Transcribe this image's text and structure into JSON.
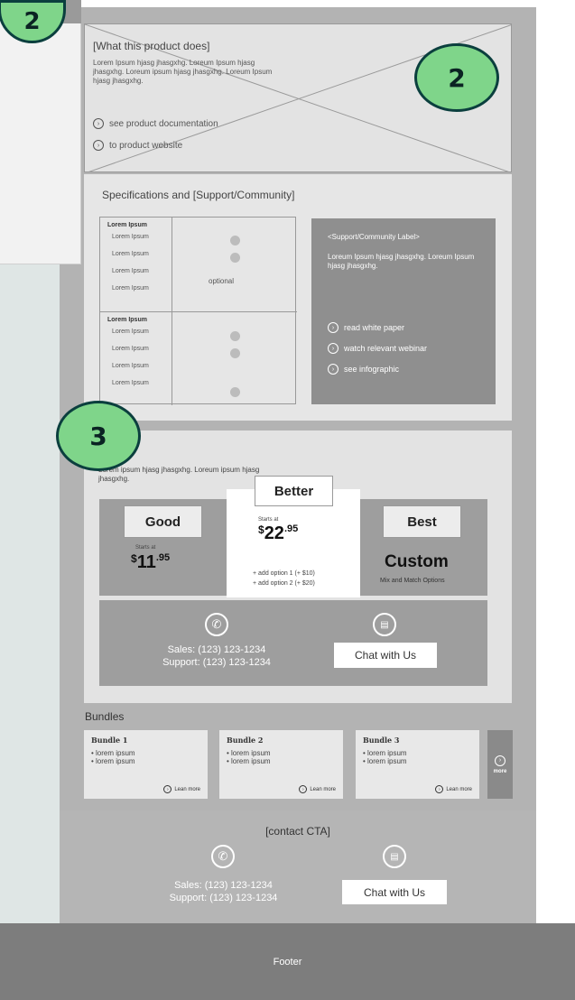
{
  "product": {
    "heading": "[What this product does]",
    "body": "Lorem Ipsum hjasg jhasgxhg. Loreum Ipsum hjasg jhasgxhg. Loreum ipsum hjasg jhasgxhg. Loreum Ipsum hjasg jhasgxhg.",
    "links": [
      "see product documentation",
      "to product website"
    ]
  },
  "badges": [
    "2",
    "2",
    "3"
  ],
  "specs": {
    "heading": "Specifications and [Support/Community]",
    "groups": [
      {
        "title": "Lorem Ipsum",
        "rows": [
          "Lorem Ipsum",
          "Lorem Ipsum",
          "Lorem Ipsum",
          "Lorem Ipsum"
        ],
        "values": [
          "check",
          "check",
          "optional",
          ""
        ]
      },
      {
        "title": "Lorem Ipsum",
        "rows": [
          "Lorem Ipsum",
          "Lorem Ipsum",
          "Lorem Ipsum",
          "Lorem Ipsum"
        ],
        "values": [
          "check",
          "check",
          "",
          "check"
        ]
      }
    ],
    "optional_text": "optional"
  },
  "support": {
    "label": "<Support/Community Label>",
    "body": "Loreum Ipsum hjasg jhasgxhg. Loreum Ipsum hjasg jhasgxhg.",
    "links": [
      "read white paper",
      "watch relevant webinar",
      "see infographic"
    ]
  },
  "pricing": {
    "intro": "Lorem ipsum hjasg jhasgxhg. Loreum ipsum hjasg jhasgxhg.",
    "good": {
      "label": "Good",
      "starts": "Starts at",
      "currency": "$",
      "whole": "11",
      "cents": ".95"
    },
    "better": {
      "label": "Better",
      "starts": "Starts at",
      "currency": "$",
      "whole": "22",
      "cents": ".95",
      "options": [
        "+ add option 1 (+ $10)",
        "+ add option 2 (+ $20)"
      ]
    },
    "best": {
      "label": "Best",
      "title": "Custom",
      "sub": "Mix and Match Options"
    },
    "sales": "Sales: (123) 123-1234",
    "support": "Support: (123) 123-1234",
    "chat": "Chat with Us"
  },
  "bundles": {
    "heading": "Bundles",
    "items": [
      {
        "title": "Bundle 1",
        "lines": [
          "• lorem ipsum",
          "• lorem ipsum"
        ],
        "learn": "Lean more"
      },
      {
        "title": "Bundle 2",
        "lines": [
          "• lorem ipsum",
          "• lorem ipsum"
        ],
        "learn": "Lean more"
      },
      {
        "title": "Bundle 3",
        "lines": [
          "• lorem ipsum",
          "• lorem ipsum"
        ],
        "learn": "Lean more"
      }
    ],
    "more": "more"
  },
  "cta": {
    "heading": "[contact CTA]",
    "sales": "Sales: (123) 123-1234",
    "support": "Support: (123) 123-1234",
    "chat": "Chat with Us"
  },
  "footer": "Footer",
  "colors": {
    "badge": "#7fd58a",
    "badge_border": "#0b3f3e",
    "wire": "#b3b3b3",
    "footer": "#7d7d7d"
  }
}
